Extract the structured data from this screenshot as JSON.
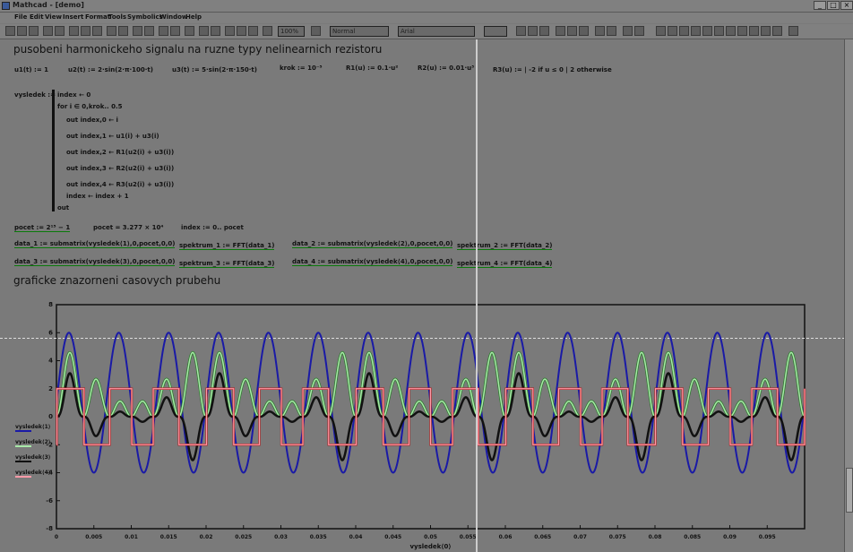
{
  "window": {
    "title": "Mathcad - [demo]",
    "buttons": [
      "_",
      "□",
      "×"
    ]
  },
  "menu": [
    "File",
    "Edit",
    "View",
    "Insert",
    "Format",
    "Tools",
    "Symbolics",
    "Window",
    "Help"
  ],
  "toolbar": {
    "zoom": "100%",
    "style": "Normal",
    "font": "Arial"
  },
  "heading1": "pusobeni harmonickeho signalu na ruzne typy nelinearnich rezistoru",
  "definitions": [
    "u1(t) := 1",
    "u2(t) := 2·sin(2·π·100·t)",
    "u3(t) := 5·sin(2·π·150·t)",
    "krok := 10⁻⁵",
    "R1(u) := 0.1·u²",
    "R2(u) := 0.01·u³",
    "R3(u) := | -2 if u ≤ 0 | 2 otherwise"
  ],
  "program": {
    "name": "vysledek :=",
    "lines": [
      "index ← 0",
      "for i ∈ 0,krok.. 0.5",
      "out index,0 ← i",
      "out index,1 ← u1(i) + u3(i)",
      "out index,2 ← R1(u2(i) + u3(i))",
      "out index,3 ← R2(u2(i) + u3(i))",
      "out index,4 ← R3(u2(i) + u3(i))",
      "index ← index + 1",
      "out"
    ]
  },
  "params": [
    "pocet := 2¹⁵ − 1",
    "pocet = 3.277 × 10⁴",
    "index := 0.. pocet"
  ],
  "data_lines": [
    "data_1 := submatrix(vysledek⟨1⟩,0,pocet,0,0)",
    "spektrum_1 := FFT(data_1)",
    "data_2 := submatrix(vysledek⟨2⟩,0,pocet,0,0)",
    "spektrum_2 := FFT(data_2)",
    "data_3 := submatrix(vysledek⟨3⟩,0,pocet,0,0)",
    "spektrum_3 := FFT(data_3)",
    "data_4 := submatrix(vysledek⟨4⟩,0,pocet,0,0)",
    "spektrum_4 := FFT(data_4)"
  ],
  "heading2": "graficke znazorneni casovych prubehu",
  "chart_data": {
    "type": "line",
    "xlabel": "vysledek⟨0⟩",
    "ylabel": "",
    "xlim": [
      0,
      0.1
    ],
    "ylim": [
      -8,
      8
    ],
    "x_ticks": [
      "0",
      "0.005",
      "0.01",
      "0.015",
      "0.02",
      "0.025",
      "0.03",
      "0.035",
      "0.04",
      "0.045",
      "0.05",
      "0.055",
      "0.06",
      "0.065",
      "0.07",
      "0.075",
      "0.08",
      "0.085",
      "0.09",
      "0.095"
    ],
    "y_ticks": [
      "-8",
      "-6",
      "-4",
      "-2",
      "0",
      "2",
      "4",
      "6",
      "8"
    ],
    "legend": [
      "vysledek⟨1⟩",
      "vysledek⟨2⟩",
      "vysledek⟨3⟩",
      "vysledek⟨4⟩"
    ],
    "series": [
      {
        "name": "vysledek⟨1⟩",
        "formula": "1 + 5·sin(2π·150·t)",
        "color": "#1a1aa6"
      },
      {
        "name": "vysledek⟨2⟩",
        "formula": "0.1·(u2+u3)²",
        "color": "#a8e8a8"
      },
      {
        "name": "vysledek⟨3⟩",
        "formula": "0.01·(u2+u3)³",
        "color": "#111111"
      },
      {
        "name": "vysledek⟨4⟩",
        "formula": "±2 step of (u2+u3)",
        "color": "#ff9aa8"
      }
    ],
    "grid": false
  }
}
